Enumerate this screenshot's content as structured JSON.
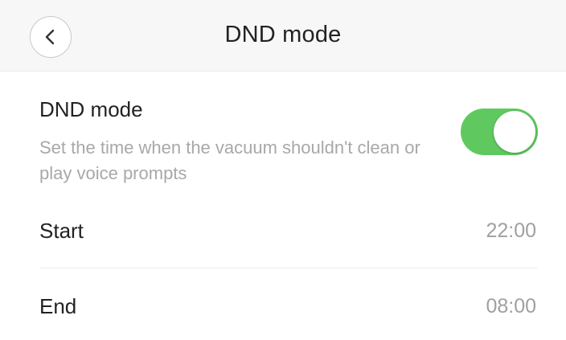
{
  "header": {
    "title": "DND mode",
    "back_icon": "chevron-left-icon"
  },
  "dnd": {
    "title": "DND mode",
    "description": "Set the time when the vacuum shouldn't clean or play voice prompts",
    "enabled": true,
    "toggle_color": "#5fc95f"
  },
  "schedule": {
    "start_label": "Start",
    "start_value": "22:00",
    "end_label": "End",
    "end_value": "08:00"
  }
}
